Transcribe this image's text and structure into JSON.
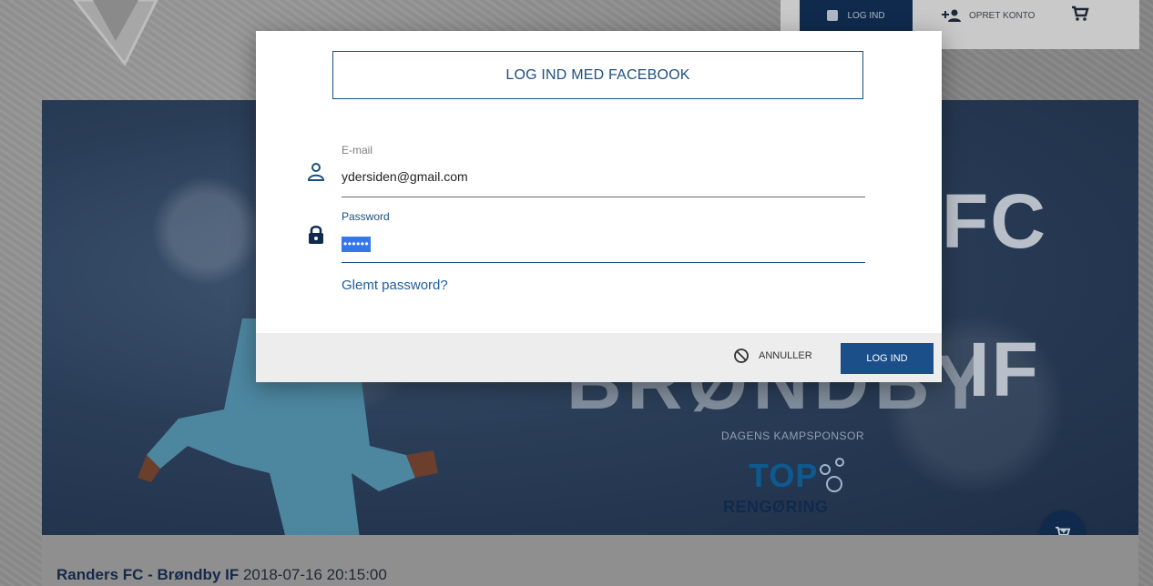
{
  "nav": {
    "login_label": "LOG IND",
    "register_label": "OPRET KONTO"
  },
  "hero": {
    "fc_text": "FC",
    "if_text": "IF",
    "brondby_text": "BRØNDBY",
    "sponsor_caption": "DAGENS KAMPSPONSOR",
    "sponsor_name_top": "TOP",
    "sponsor_name_bottom": "RENGØRING"
  },
  "match": {
    "teams": "Randers FC - Brøndby IF",
    "datetime": "2018-07-16 20:15:00"
  },
  "modal": {
    "facebook_button": "LOG IND MED FACEBOOK",
    "email": {
      "label": "E-mail",
      "value": "ydersiden@gmail.com"
    },
    "password": {
      "label": "Password",
      "value": "••••••"
    },
    "forgot_link": "Glemt password?",
    "cancel_label": "ANNULLER",
    "login_label": "LOG IND"
  },
  "colors": {
    "brand_navy": "#0f2a4d",
    "button_blue": "#1b4f8a",
    "link_blue": "#1d5ea3"
  }
}
